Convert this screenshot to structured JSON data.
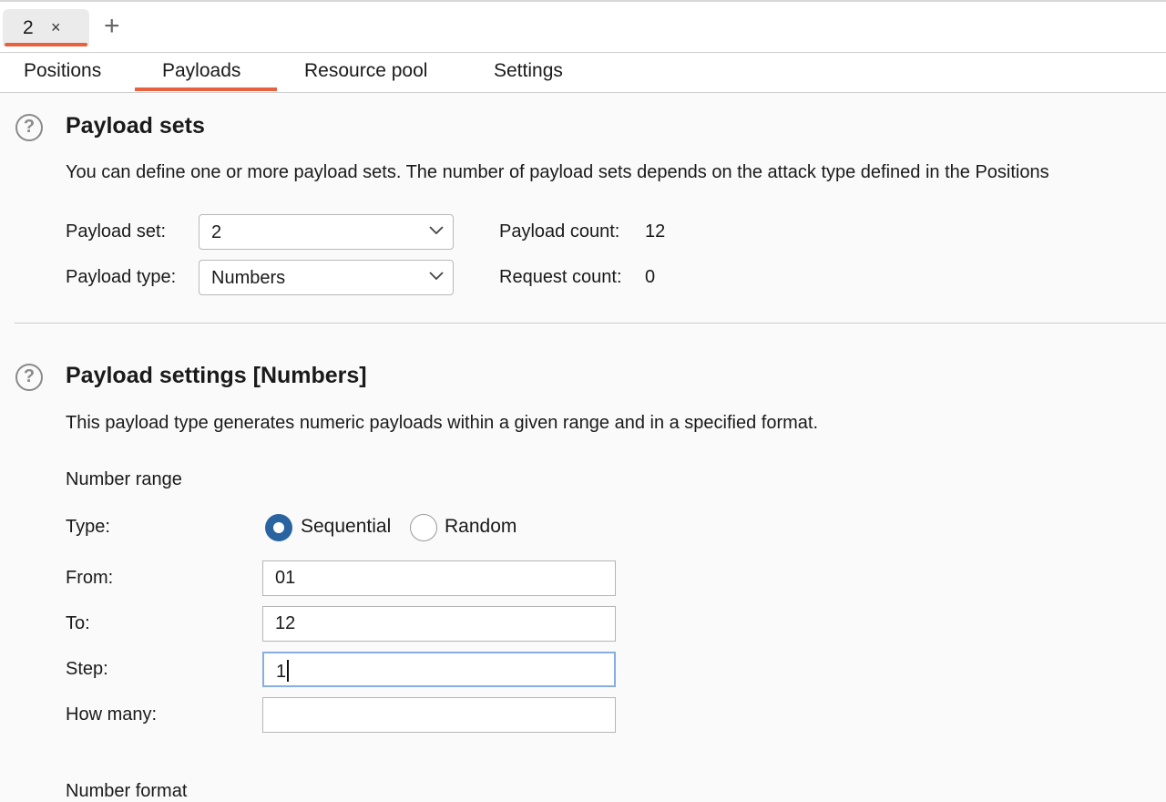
{
  "request_tab": {
    "label": "2",
    "close": "×"
  },
  "new_tab": "+",
  "subtabs": [
    {
      "label": "Positions"
    },
    {
      "label": "Payloads"
    },
    {
      "label": "Resource pool"
    },
    {
      "label": "Settings"
    }
  ],
  "active_subtab": "Payloads",
  "accent_color": "#e8613f",
  "payload_sets": {
    "title": "Payload sets",
    "description": "You can define one or more payload sets. The number of payload sets depends on the attack type defined in the Positions",
    "set_label": "Payload set:",
    "set_value": "2",
    "type_label": "Payload type:",
    "type_value": "Numbers",
    "count_label": "Payload count:",
    "count_value": "12",
    "request_label": "Request count:",
    "request_value": "0"
  },
  "payload_settings": {
    "title": "Payload settings [Numbers]",
    "description": "This payload type generates numeric payloads within a given range and in a specified format.",
    "range_heading": "Number range",
    "type_label": "Type:",
    "type_options": [
      "Sequential",
      "Random"
    ],
    "type_selected": "Sequential",
    "from_label": "From:",
    "from_value": "01",
    "to_label": "To:",
    "to_value": "12",
    "step_label": "Step:",
    "step_value": "1",
    "how_many_label": "How many:",
    "how_many_value": "",
    "format_heading": "Number format"
  },
  "icons": [
    "help-icon",
    "chevron-down-icon",
    "close-icon",
    "plus-icon"
  ]
}
